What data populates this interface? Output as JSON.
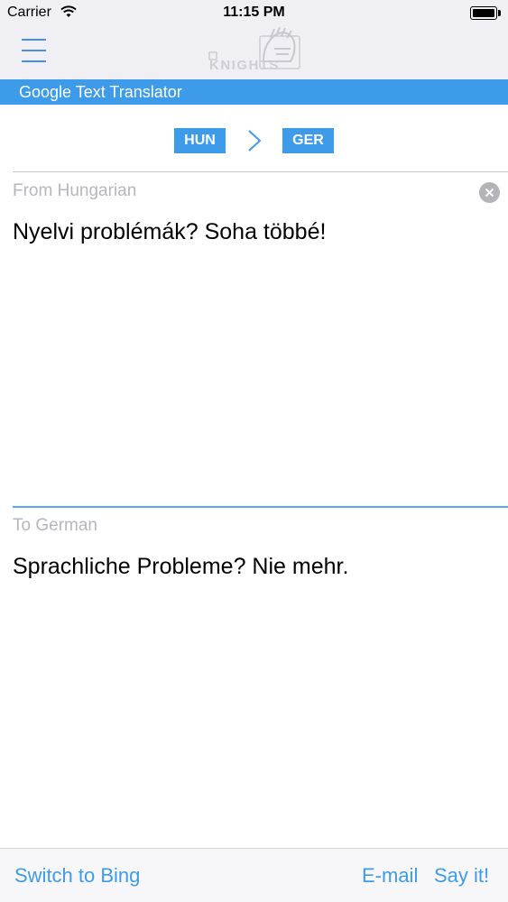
{
  "status_bar": {
    "carrier": "Carrier",
    "time": "11:15 PM"
  },
  "header": {
    "menu_icon": "hamburger-menu-icon",
    "logo_text": "KNIGHTS",
    "title": "Google Text Translator"
  },
  "languages": {
    "from_code": "HUN",
    "to_code": "GER",
    "arrow_icon": "chevron-right-icon"
  },
  "source": {
    "label": "From Hungarian",
    "text": "Nyelvi problémák? Soha többé!",
    "clear_icon": "clear-icon"
  },
  "target": {
    "label": "To German",
    "text": "Sprachliche Probleme? Nie mehr."
  },
  "footer": {
    "switch_label": "Switch to Bing",
    "email_label": "E-mail",
    "say_label": "Say it!"
  },
  "colors": {
    "accent": "#3d9be9",
    "header_bg": "#efeff4",
    "label_gray": "#b6b6bc"
  }
}
